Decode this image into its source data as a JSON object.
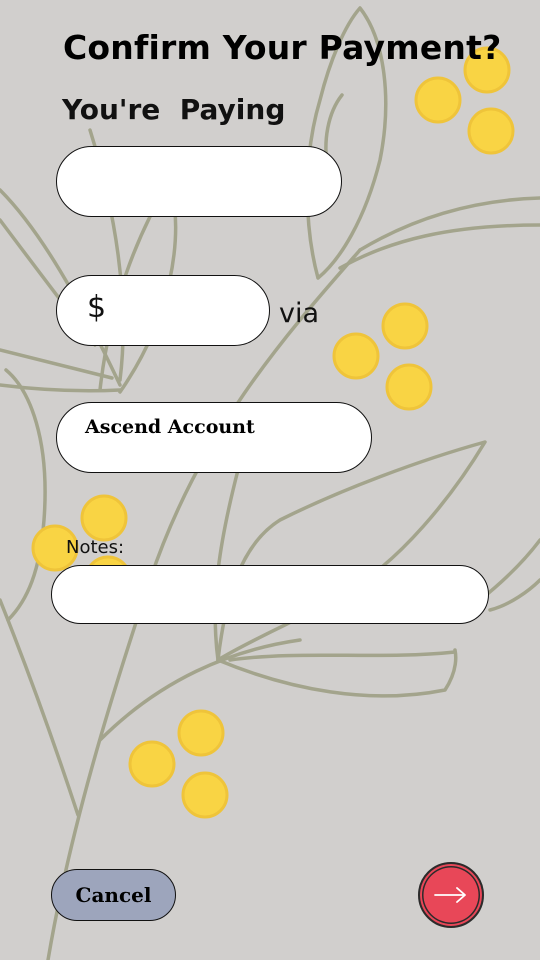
{
  "page": {
    "title": "Confirm Your Payment?",
    "subtitle": "You're  Paying"
  },
  "form": {
    "payee_value": "",
    "currency_symbol": "$",
    "amount_value": "",
    "via_label": "via",
    "account_label": "Ascend Account",
    "notes_label": "Notes:",
    "notes_value": ""
  },
  "actions": {
    "cancel_label": "Cancel",
    "next_icon": "arrow-right-icon"
  },
  "colors": {
    "background": "#d1cfcd",
    "leaf_line": "#a3a48c",
    "coin": "#f9d444",
    "cancel_button": "#9da5bc",
    "next_button": "#e84758"
  }
}
